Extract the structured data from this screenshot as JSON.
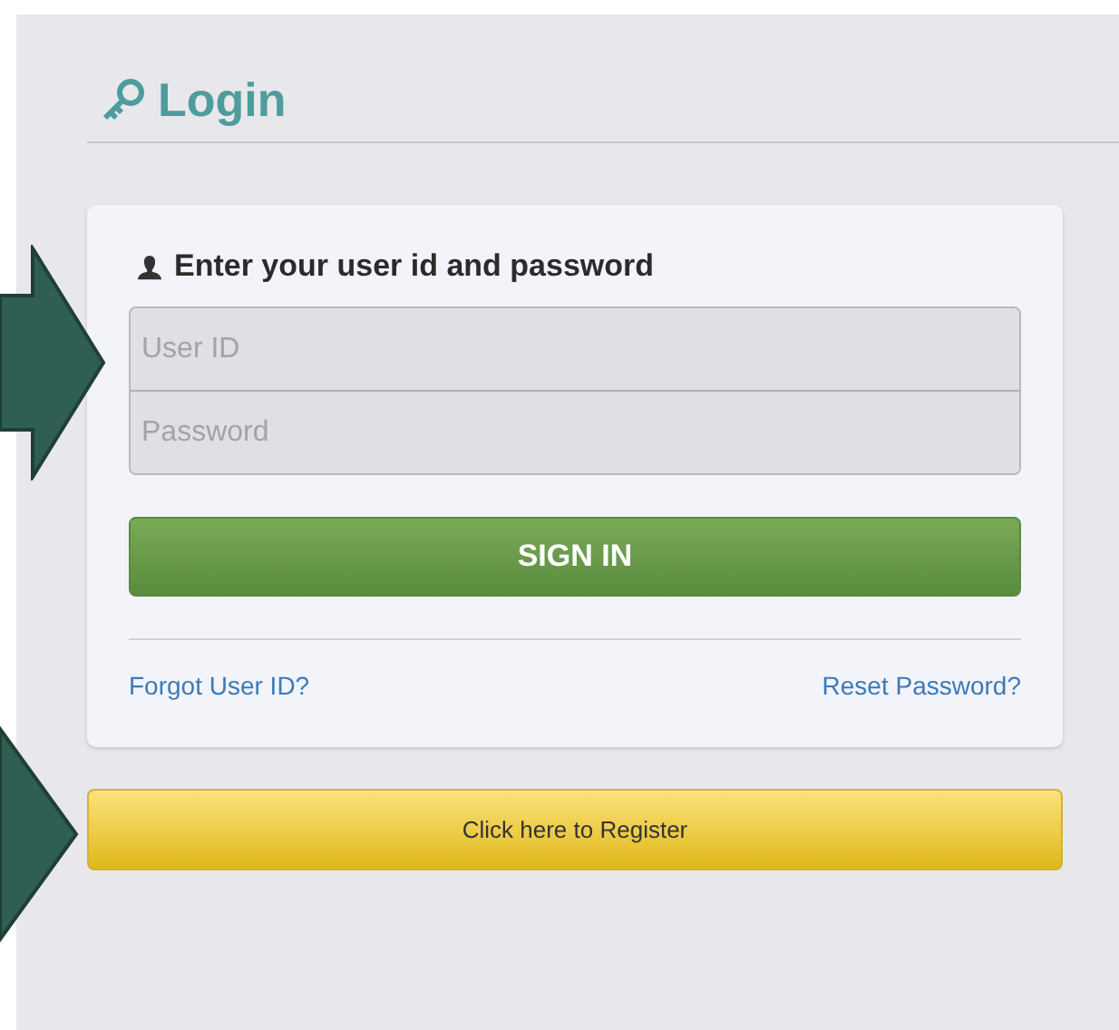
{
  "page": {
    "title": "Login"
  },
  "form": {
    "heading": "Enter your user id and password",
    "fields": [
      {
        "placeholder": "User ID"
      },
      {
        "placeholder": "Password"
      }
    ],
    "submit": "SIGN IN",
    "links": [
      "Forgot User ID?",
      "Reset Password?"
    ]
  },
  "register_button": "Click here to Register"
}
